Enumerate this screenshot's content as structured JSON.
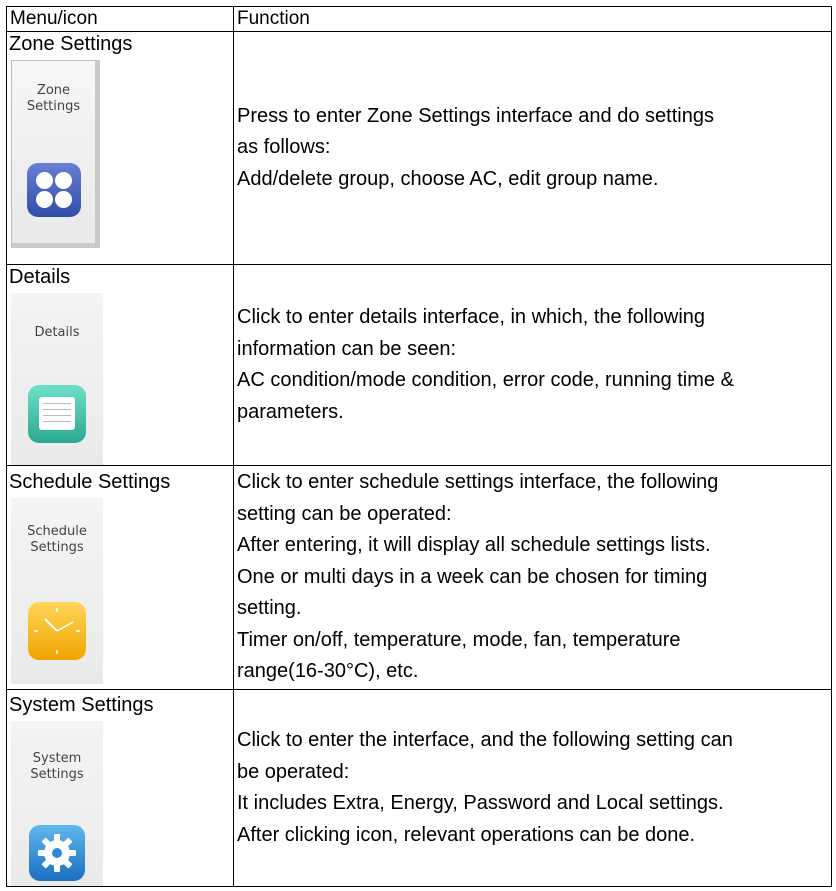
{
  "header": {
    "col1": "Menu/icon",
    "col2": "Function"
  },
  "rows": [
    {
      "name": "Zone Settings",
      "icon_label_line1": "Zone",
      "icon_label_line2": "Settings",
      "icon": "zone-grid-icon",
      "function_lines": [
        "Press to enter Zone Settings interface and do settings",
        "as follows:",
        "Add/delete group, choose AC, edit group name."
      ]
    },
    {
      "name": "Details",
      "icon_label_line1": "Details",
      "icon": "notepad-icon",
      "function_lines": [
        "Click to enter details interface, in which, the following",
        "information can be seen:",
        "AC condition/mode condition, error code, running time &",
        "parameters."
      ]
    },
    {
      "name": "Schedule Settings",
      "icon_label_line1": "Schedule",
      "icon_label_line2": "Settings",
      "icon": "clock-icon",
      "function_lines": [
        "Click to enter schedule settings interface, the following",
        "setting can be operated:",
        "After entering, it will display all schedule settings lists.",
        "One or multi days in a week can be chosen for timing",
        "setting.",
        "Timer on/off, temperature, mode, fan, temperature",
        "range(16-30°C), etc."
      ]
    },
    {
      "name": "System Settings",
      "icon_label_line1": "System",
      "icon_label_line2": "Settings",
      "icon": "gear-icon",
      "function_lines": [
        "Click to enter the interface, and the following setting can",
        "be operated:",
        "It includes Extra, Energy, Password and Local settings.",
        "After clicking icon, relevant operations can be done."
      ]
    }
  ],
  "colors": {
    "border": "#000000",
    "zone_icon": "#3a57b5",
    "details_icon": "#3cc3a8",
    "clock_icon": "#f5b81c",
    "gear_icon": "#2f8ad8"
  }
}
